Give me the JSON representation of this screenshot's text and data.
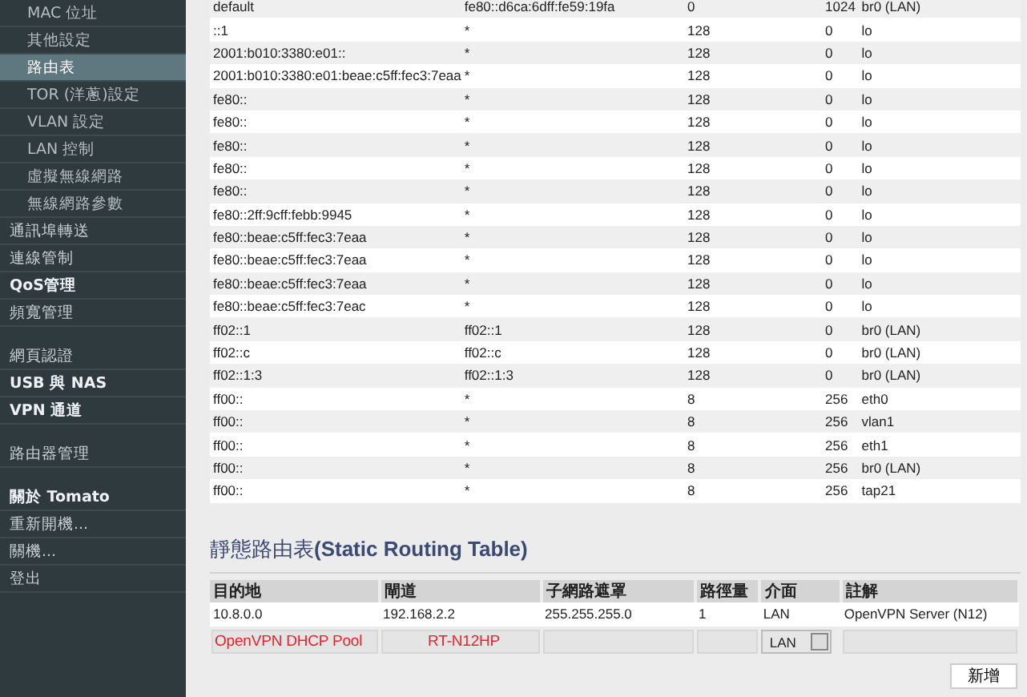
{
  "sidebar": {
    "groups": [
      {
        "items": [
          {
            "label": "MAC 位址",
            "kind": "sub",
            "bold": false,
            "selected": false
          },
          {
            "label": "其他設定",
            "kind": "sub",
            "bold": false,
            "selected": false
          },
          {
            "label": "路由表",
            "kind": "sub",
            "bold": false,
            "selected": true
          },
          {
            "label": "TOR (洋蔥)設定",
            "kind": "sub",
            "bold": false,
            "selected": false
          },
          {
            "label": "VLAN 設定",
            "kind": "sub",
            "bold": false,
            "selected": false
          },
          {
            "label": "LAN 控制",
            "kind": "sub",
            "bold": false,
            "selected": false
          },
          {
            "label": "虛擬無線網路",
            "kind": "sub",
            "bold": false,
            "selected": false
          },
          {
            "label": "無線網路參數",
            "kind": "sub",
            "bold": false,
            "selected": false
          },
          {
            "label": "通訊埠轉送",
            "kind": "main",
            "bold": false,
            "selected": false
          },
          {
            "label": "連線管制",
            "kind": "main",
            "bold": false,
            "selected": false
          },
          {
            "label": "QoS管理",
            "kind": "main",
            "bold": true,
            "selected": false
          },
          {
            "label": "頻寬管理",
            "kind": "main",
            "bold": false,
            "selected": false
          }
        ]
      },
      {
        "items": [
          {
            "label": "網頁認證",
            "kind": "main",
            "bold": false,
            "selected": false
          },
          {
            "label": "USB 與 NAS",
            "kind": "main",
            "bold": true,
            "selected": false
          },
          {
            "label": "VPN 通道",
            "kind": "main",
            "bold": true,
            "selected": false
          }
        ]
      },
      {
        "items": [
          {
            "label": "路由器管理",
            "kind": "main",
            "bold": false,
            "selected": false
          }
        ]
      },
      {
        "items": [
          {
            "label": "關於 Tomato",
            "kind": "main",
            "bold": true,
            "selected": false
          },
          {
            "label": "重新開機...",
            "kind": "main",
            "bold": false,
            "selected": false
          },
          {
            "label": "關機...",
            "kind": "main",
            "bold": false,
            "selected": false
          },
          {
            "label": "登出",
            "kind": "main",
            "bold": false,
            "selected": false
          }
        ]
      }
    ]
  },
  "routes": {
    "rows": [
      [
        "default",
        "fe80::d6ca:6dff:fe59:19fa",
        "0",
        "1024",
        "br0 (LAN)"
      ],
      [
        "::1",
        "*",
        "128",
        "0",
        "lo"
      ],
      [
        "2001:b010:3380:e01::",
        "*",
        "128",
        "0",
        "lo"
      ],
      [
        "2001:b010:3380:e01:beae:c5ff:fec3:7eaa",
        "*",
        "128",
        "0",
        "lo"
      ],
      [
        "fe80::",
        "*",
        "128",
        "0",
        "lo"
      ],
      [
        "fe80::",
        "*",
        "128",
        "0",
        "lo"
      ],
      [
        "fe80::",
        "*",
        "128",
        "0",
        "lo"
      ],
      [
        "fe80::",
        "*",
        "128",
        "0",
        "lo"
      ],
      [
        "fe80::",
        "*",
        "128",
        "0",
        "lo"
      ],
      [
        "fe80::2ff:9cff:febb:9945",
        "*",
        "128",
        "0",
        "lo"
      ],
      [
        "fe80::beae:c5ff:fec3:7eaa",
        "*",
        "128",
        "0",
        "lo"
      ],
      [
        "fe80::beae:c5ff:fec3:7eaa",
        "*",
        "128",
        "0",
        "lo"
      ],
      [
        "fe80::beae:c5ff:fec3:7eaa",
        "*",
        "128",
        "0",
        "lo"
      ],
      [
        "fe80::beae:c5ff:fec3:7eac",
        "*",
        "128",
        "0",
        "lo"
      ],
      [
        "ff02::1",
        "ff02::1",
        "128",
        "0",
        "br0 (LAN)"
      ],
      [
        "ff02::c",
        "ff02::c",
        "128",
        "0",
        "br0 (LAN)"
      ],
      [
        "ff02::1:3",
        "ff02::1:3",
        "128",
        "0",
        "br0 (LAN)"
      ],
      [
        "ff00::",
        "*",
        "8",
        "256",
        "eth0"
      ],
      [
        "ff00::",
        "*",
        "8",
        "256",
        "vlan1"
      ],
      [
        "ff00::",
        "*",
        "8",
        "256",
        "eth1"
      ],
      [
        "ff00::",
        "*",
        "8",
        "256",
        "br0 (LAN)"
      ],
      [
        "ff00::",
        "*",
        "8",
        "256",
        "tap21"
      ]
    ]
  },
  "static_routes": {
    "title": "靜態路由表**(Static Routing Table)**",
    "columns": [
      "目的地",
      "閘道",
      "子網路遮罩",
      "路徑量",
      "介面",
      "註解"
    ],
    "rows": [
      [
        "10.8.0.0",
        "192.168.2.2",
        "255.255.255.0",
        "1",
        "LAN",
        "OpenVPN Server (N12)"
      ]
    ],
    "new_row": {
      "interface": "LAN"
    },
    "annotations": [
      {
        "text": "OpenVPN DHCP Pool"
      },
      {
        "text": "RT-N12HP"
      }
    ],
    "add_button": "新增"
  }
}
